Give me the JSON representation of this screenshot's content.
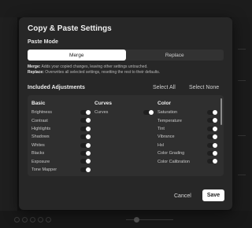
{
  "dialog": {
    "title": "Copy & Paste Settings",
    "paste_mode_label": "Paste Mode",
    "paste_modes": [
      {
        "label": "Merge",
        "selected": true
      },
      {
        "label": "Replace",
        "selected": false
      }
    ],
    "merge_desc_title": "Merge:",
    "merge_desc": "Adds your copied changes, leaving other settings untouched.",
    "replace_desc_title": "Replace:",
    "replace_desc": "Overwrites all selected settings, resetting the rest to their defaults.",
    "included_label": "Included Adjustments",
    "select_all": "Select All",
    "select_none": "Select None",
    "columns": {
      "basic": {
        "title": "Basic",
        "items": [
          {
            "label": "Brightness",
            "on": true
          },
          {
            "label": "Contrast",
            "on": true
          },
          {
            "label": "Highlights",
            "on": true
          },
          {
            "label": "Shadows",
            "on": true
          },
          {
            "label": "Whites",
            "on": true
          },
          {
            "label": "Blacks",
            "on": true
          },
          {
            "label": "Exposure",
            "on": true
          },
          {
            "label": "Tone Mapper",
            "on": true
          }
        ]
      },
      "curves": {
        "title": "Curves",
        "items": [
          {
            "label": "Curves",
            "on": true
          }
        ]
      },
      "color": {
        "title": "Color",
        "items": [
          {
            "label": "Saturation",
            "on": true
          },
          {
            "label": "Temperature",
            "on": true
          },
          {
            "label": "Tint",
            "on": true
          },
          {
            "label": "Vibrance",
            "on": true
          },
          {
            "label": "Hsl",
            "on": true
          },
          {
            "label": "Color Grading",
            "on": true
          },
          {
            "label": "Color Calibration",
            "on": true
          }
        ]
      }
    },
    "cancel_label": "Cancel",
    "save_label": "Save"
  },
  "colors": {
    "modal_bg": "#272727",
    "panel_bg": "#2f2f2f",
    "toggle_on_knob": "#ffffff",
    "accent_button": "#ffffff"
  }
}
